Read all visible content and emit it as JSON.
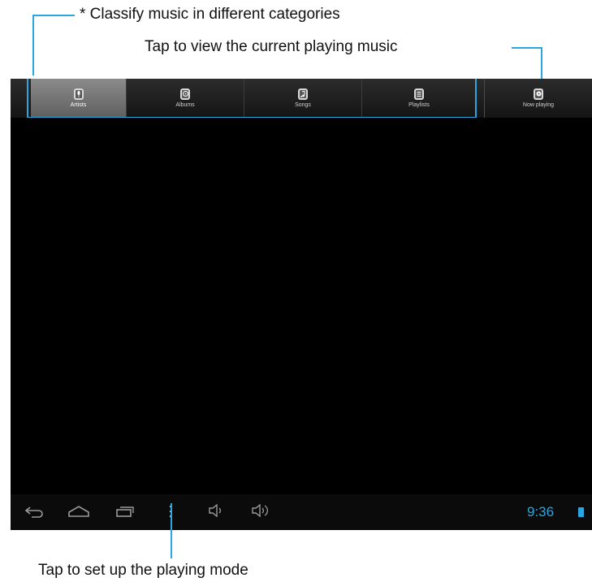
{
  "callouts": {
    "classify": "* Classify music in different categories",
    "now_playing": "Tap to view the current playing music",
    "playing_mode": "Tap to set up the playing mode"
  },
  "tabs": [
    {
      "label": "Artists",
      "icon": "microphone-icon",
      "selected": true
    },
    {
      "label": "Albums",
      "icon": "album-disc-icon",
      "selected": false
    },
    {
      "label": "Songs",
      "icon": "music-note-icon",
      "selected": false
    },
    {
      "label": "Playlists",
      "icon": "playlist-icon",
      "selected": false
    },
    {
      "label": "Now playing",
      "icon": "now-playing-icon",
      "selected": false
    }
  ],
  "navbar": {
    "icons": [
      "back-icon",
      "home-icon",
      "recent-apps-icon",
      "menu-icon",
      "volume-down-icon",
      "volume-up-icon"
    ],
    "time": "9:36",
    "status_icon": "battery-icon"
  },
  "colors": {
    "accent": "#2aa7e0",
    "screen_bg": "#000000",
    "selected_tab": "#7a7a7a"
  }
}
